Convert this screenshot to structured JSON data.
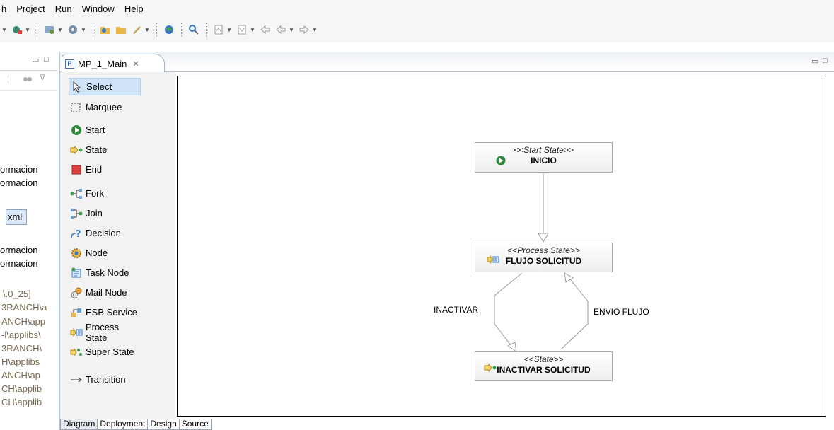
{
  "menu": [
    "h",
    "Project",
    "Run",
    "Window",
    "Help"
  ],
  "left_view": {
    "items_top": [
      "ormacion",
      "ormacion"
    ],
    "xml_label": "xml",
    "items_mid": [
      "ormacion",
      "ormacion"
    ],
    "paths": [
      "\\.0_25]",
      "3RANCH\\a",
      "ANCH\\app",
      "-l\\applibs\\",
      "3RANCH\\",
      "H\\applibs",
      "ANCH\\ap",
      "CH\\applib",
      "CH\\applib"
    ]
  },
  "editor": {
    "tab_label": "MP_1_Main",
    "tab_close": "✕",
    "bottom_tabs": [
      "Diagram",
      "Deployment",
      "Design",
      "Source"
    ]
  },
  "palette": {
    "items": [
      "Select",
      "Marquee",
      "Start",
      "State",
      "End",
      "Fork",
      "Join",
      "Decision",
      "Node",
      "Task Node",
      "Mail Node",
      "ESB Service",
      "Process State",
      "Super State",
      "Transition"
    ],
    "selected": "Select"
  },
  "diagram": {
    "nodes": [
      {
        "stereotype": "<<Start State>>",
        "name": "INICIO",
        "icon": "start-icon"
      },
      {
        "stereotype": "<<Process State>>",
        "name": "FLUJO SOLICITUD",
        "icon": "process-state-icon"
      },
      {
        "stereotype": "<<State>>",
        "name": "INACTIVAR SOLICITUD",
        "icon": "state-icon"
      }
    ],
    "transitions": [
      "INACTIVAR",
      "ENVIO FLUJO"
    ]
  },
  "colors": {
    "start_green": "#2e8b3a",
    "end_red": "#e0403c",
    "state_yellow": "#d9a400",
    "selection_blue": "#cfe3f7"
  }
}
